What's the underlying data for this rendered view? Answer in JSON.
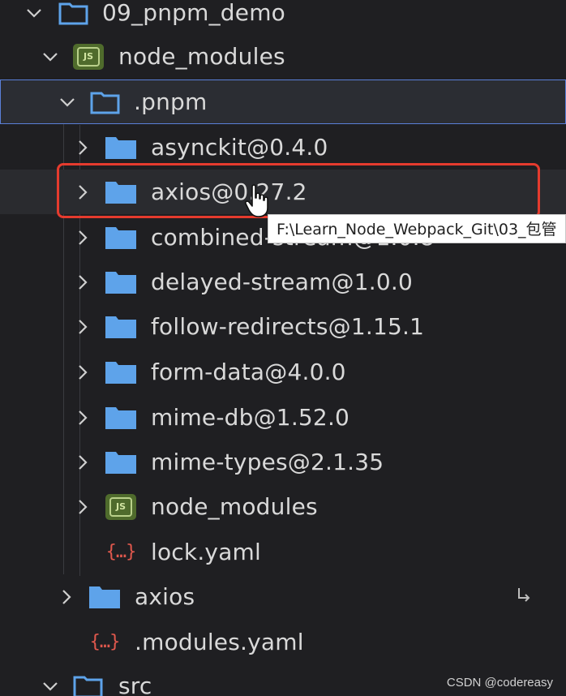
{
  "tree": {
    "root_folder": "09_pnpm_demo",
    "node_modules_folder": "node_modules",
    "pnpm_folder": ".pnpm",
    "pnpm_children": [
      "asynckit@0.4.0",
      "axios@0.27.2",
      "combined-stream@1.0.8",
      "delayed-stream@1.0.0",
      "follow-redirects@1.15.1",
      "form-data@4.0.0",
      "mime-db@1.52.0",
      "mime-types@2.1.35",
      "node_modules",
      "lock.yaml"
    ],
    "axios_link": "axios",
    "modules_yaml": ".modules.yaml",
    "src_folder": "src"
  },
  "tooltip": {
    "path": "F:\\Learn_Node_Webpack_Git\\03_包管"
  },
  "icons": {
    "folder": "folder-icon",
    "node_modules": "nodejs-folder-icon",
    "yaml": "yaml-braces-icon",
    "chevron_right": "chevron-right-icon",
    "chevron_down": "chevron-down-icon",
    "symlink": "symlink-arrow-icon"
  },
  "colors": {
    "folder_blue": "#5ea3ea",
    "highlight_red": "#e53b2e",
    "selection_border": "#5a7fd8",
    "background": "#1f1f22"
  },
  "watermark": "CSDN @codereasy"
}
